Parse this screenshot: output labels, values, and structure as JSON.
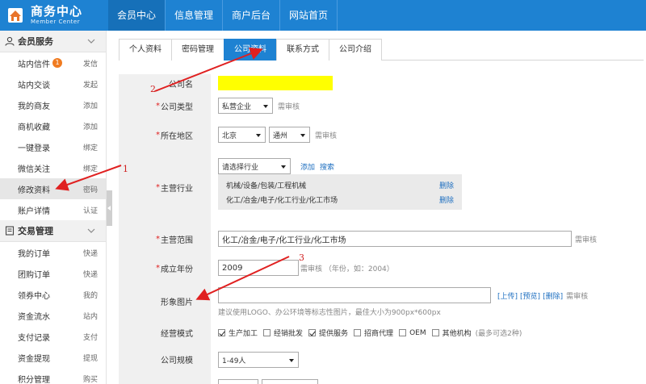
{
  "header": {
    "logo_title": "商务中心",
    "logo_sub": "Member Center",
    "nav": [
      "会员中心",
      "信息管理",
      "商户后台",
      "网站首页"
    ]
  },
  "sidebar": {
    "group1": "会员服务",
    "items1": [
      {
        "label": "站内信件",
        "badge": "1",
        "action": "发信"
      },
      {
        "label": "站内交谈",
        "action": "发起"
      },
      {
        "label": "我的商友",
        "action": "添加"
      },
      {
        "label": "商机收藏",
        "action": "添加"
      },
      {
        "label": "一键登录",
        "action": "绑定"
      },
      {
        "label": "微信关注",
        "action": "绑定"
      },
      {
        "label": "修改资料",
        "action": "密码"
      },
      {
        "label": "账户详情",
        "action": "认证"
      }
    ],
    "group2": "交易管理",
    "items2": [
      {
        "label": "我的订单",
        "action": "快递"
      },
      {
        "label": "团购订单",
        "action": "快递"
      },
      {
        "label": "领券中心",
        "action": "我的"
      },
      {
        "label": "资金流水",
        "action": "站内"
      },
      {
        "label": "支付记录",
        "action": "支付"
      },
      {
        "label": "资金提现",
        "action": "提现"
      },
      {
        "label": "积分管理",
        "action": "购买"
      }
    ]
  },
  "tabs": [
    "个人资料",
    "密码管理",
    "公司资料",
    "联系方式",
    "公司介绍"
  ],
  "form": {
    "company_name_label": "公司名",
    "company_type": {
      "label": "公司类型",
      "value": "私营企业",
      "hint": "需审核"
    },
    "region": {
      "label": "所在地区",
      "province": "北京",
      "city": "通州",
      "hint": "需审核"
    },
    "industry": {
      "label": "主营行业",
      "select": "请选择行业",
      "add": "添加",
      "search": "搜索",
      "items": [
        "机械/设备/包装/工程机械",
        "化工/冶金/电子/化工行业/化工市场"
      ],
      "delete": "删除"
    },
    "scope": {
      "label": "主营范围",
      "value": "化工/冶金/电子/化工行业/化工市场",
      "hint": "需审核"
    },
    "year": {
      "label": "成立年份",
      "value": "2009",
      "hint": "需审核 （年份，如：2004）"
    },
    "image": {
      "label": "形象图片",
      "upload": "[上传]",
      "preview": "[预览]",
      "delete": "[删除]",
      "hint": "需审核",
      "tip": "建议使用LOGO、办公环境等标志性图片，最佳大小为900px*600px"
    },
    "mode": {
      "label": "经营模式",
      "options": [
        {
          "text": "生产加工",
          "checked": true
        },
        {
          "text": "经销批发",
          "checked": false
        },
        {
          "text": "提供服务",
          "checked": true
        },
        {
          "text": "招商代理",
          "checked": false
        },
        {
          "text": "OEM",
          "checked": false
        },
        {
          "text": "其他机构",
          "checked": false
        }
      ],
      "hint": "(最多可选2种)"
    },
    "size": {
      "label": "公司规模",
      "value": "1-49人"
    }
  },
  "annotations": [
    "1",
    "2",
    "3"
  ],
  "colors": {
    "primary": "#1e82d2",
    "annotation": "#e02020",
    "highlight": "#ffff00"
  }
}
